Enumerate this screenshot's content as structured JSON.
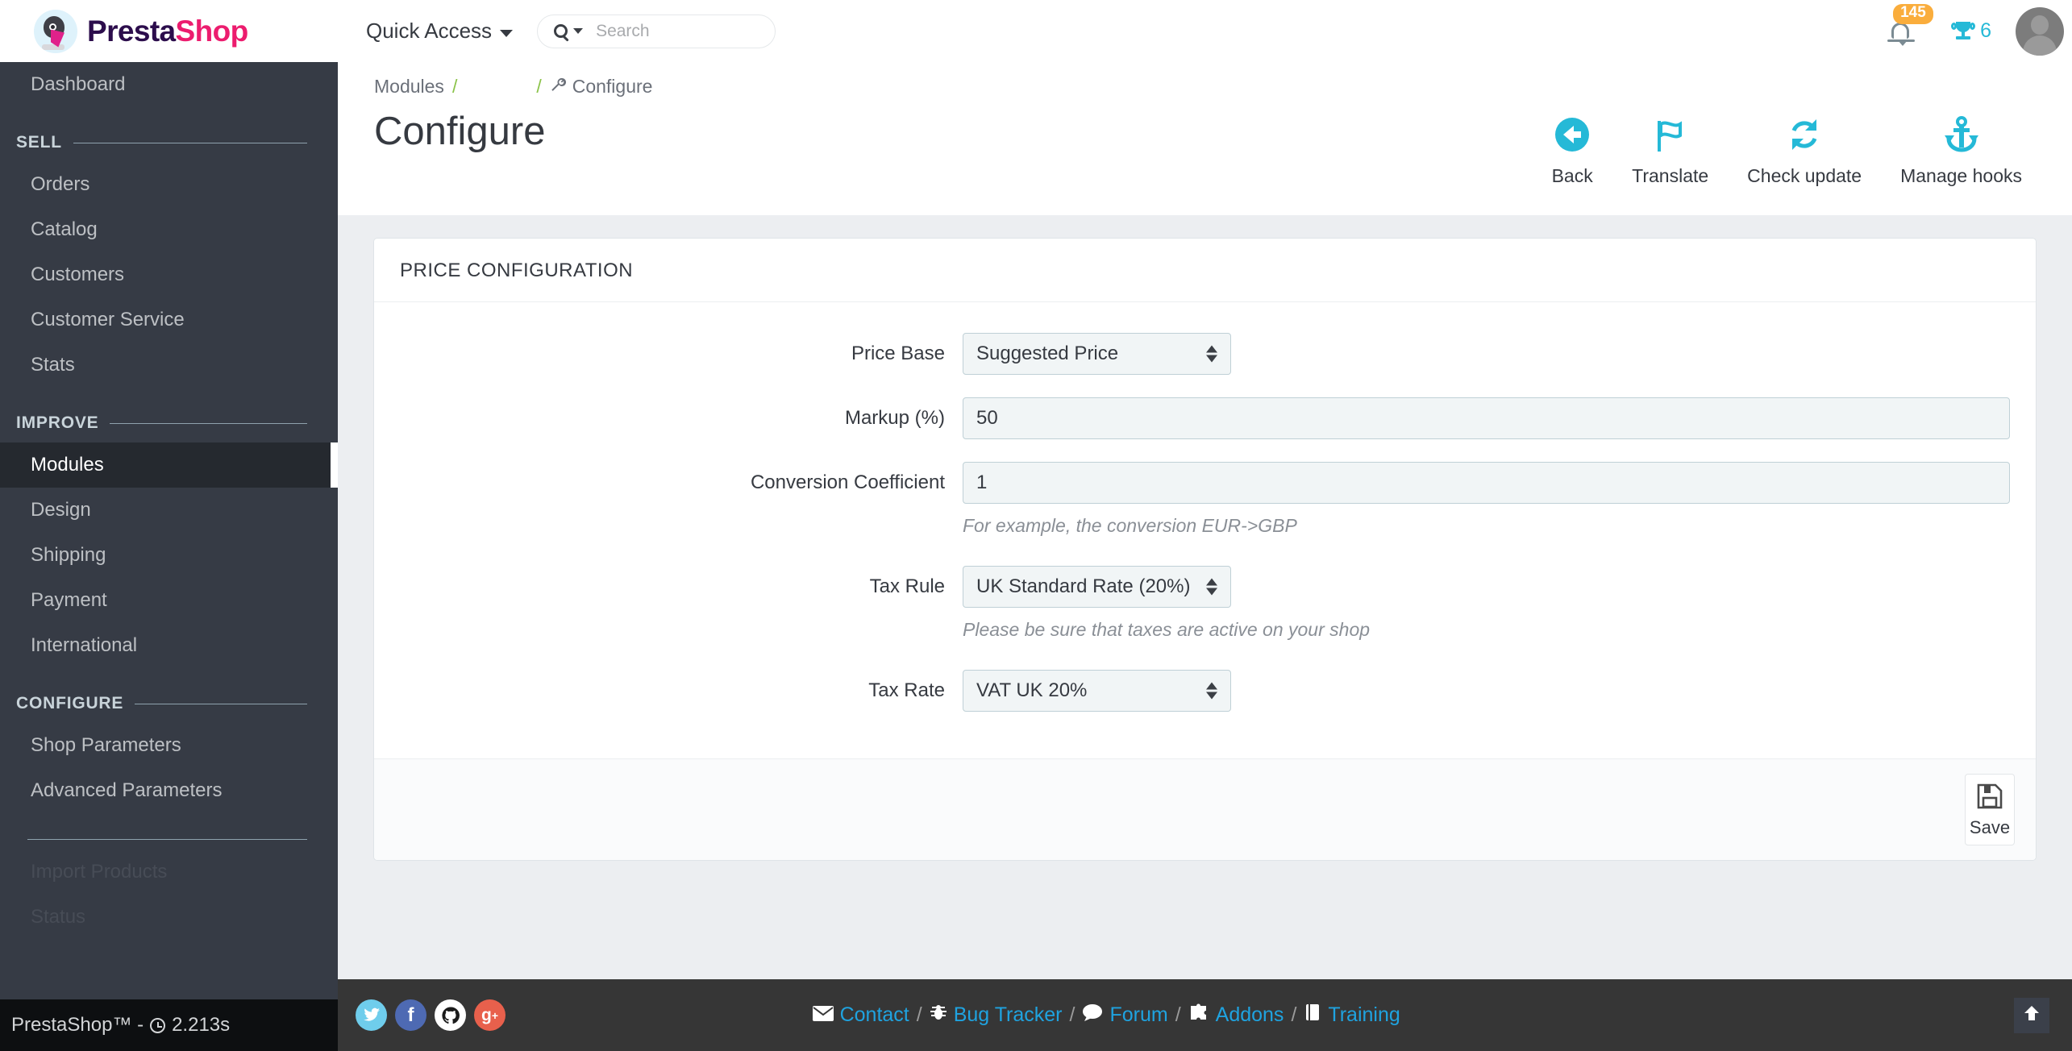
{
  "brand": {
    "name_part1": "Presta",
    "name_part2": "Shop",
    "logo_icon": "prestashop-bird-logo"
  },
  "header": {
    "quick_access_label": "Quick Access",
    "search": {
      "placeholder": "Search",
      "value": "",
      "icon": "magnifier-icon"
    },
    "notifications": {
      "count": "145",
      "icon": "bell-icon"
    },
    "trophy": {
      "count": "6",
      "icon": "trophy-icon"
    },
    "avatar_icon": "user-avatar"
  },
  "sidebar": {
    "dashboard": {
      "label": "Dashboard"
    },
    "sections": [
      {
        "label": "SELL",
        "items": [
          {
            "label": "Orders",
            "active": false
          },
          {
            "label": "Catalog",
            "active": false
          },
          {
            "label": "Customers",
            "active": false
          },
          {
            "label": "Customer Service",
            "active": false
          },
          {
            "label": "Stats",
            "active": false
          }
        ]
      },
      {
        "label": "IMPROVE",
        "items": [
          {
            "label": "Modules",
            "active": true
          },
          {
            "label": "Design",
            "active": false
          },
          {
            "label": "Shipping",
            "active": false
          },
          {
            "label": "Payment",
            "active": false
          },
          {
            "label": "International",
            "active": false
          }
        ]
      },
      {
        "label": "CONFIGURE",
        "items": [
          {
            "label": "Shop Parameters",
            "active": false
          },
          {
            "label": "Advanced Parameters",
            "active": false
          }
        ]
      },
      {
        "label": "",
        "items": [
          {
            "label": "Import Products",
            "active": false
          },
          {
            "label": "Status",
            "active": false
          }
        ]
      }
    ],
    "footer": {
      "text": "PrestaShop™ -",
      "load_time": "2.213s",
      "clock_icon": "clock-icon"
    }
  },
  "page": {
    "breadcrumb": {
      "root": "Modules",
      "current": "Configure",
      "separator": "/",
      "current_icon": "wrench-icon"
    },
    "title": "Configure",
    "toolbar": [
      {
        "label": "Back",
        "icon": "arrow-left-circle-icon"
      },
      {
        "label": "Translate",
        "icon": "flag-icon"
      },
      {
        "label": "Check update",
        "icon": "refresh-icon"
      },
      {
        "label": "Manage hooks",
        "icon": "anchor-icon"
      }
    ]
  },
  "panel": {
    "title": "PRICE CONFIGURATION",
    "fields": [
      {
        "label": "Price Base",
        "type": "select",
        "value": "Suggested Price",
        "hint": ""
      },
      {
        "label": "Markup (%)",
        "type": "text",
        "value": "50",
        "hint": ""
      },
      {
        "label": "Conversion Coefficient",
        "type": "text",
        "value": "1",
        "hint": "For example, the conversion EUR->GBP"
      },
      {
        "label": "Tax Rule",
        "type": "select",
        "value": "UK Standard Rate (20%)",
        "hint": "Please be sure that taxes are active on your shop"
      },
      {
        "label": "Tax Rate",
        "type": "select",
        "value": "VAT UK 20%",
        "hint": ""
      }
    ],
    "save_label": "Save",
    "save_icon": "floppy-disk-icon"
  },
  "footer": {
    "social": [
      {
        "name": "twitter",
        "glyph": "🕊"
      },
      {
        "name": "facebook",
        "glyph": "f"
      },
      {
        "name": "github",
        "glyph": "●"
      },
      {
        "name": "google-plus",
        "glyph": "g+"
      }
    ],
    "links": [
      {
        "label": "Contact",
        "icon": "envelope-icon"
      },
      {
        "label": "Bug Tracker",
        "icon": "bug-icon"
      },
      {
        "label": "Forum",
        "icon": "comment-icon"
      },
      {
        "label": "Addons",
        "icon": "puzzle-icon"
      },
      {
        "label": "Training",
        "icon": "book-icon"
      }
    ],
    "separator": "/",
    "scroll_top_icon": "arrow-up-icon"
  },
  "colors": {
    "accent_cyan": "#25b9d7",
    "link_blue": "#1fa3e0",
    "badge_orange": "#faad3c",
    "sidebar_bg": "#363b45",
    "brand_pink": "#ec1c6e"
  }
}
